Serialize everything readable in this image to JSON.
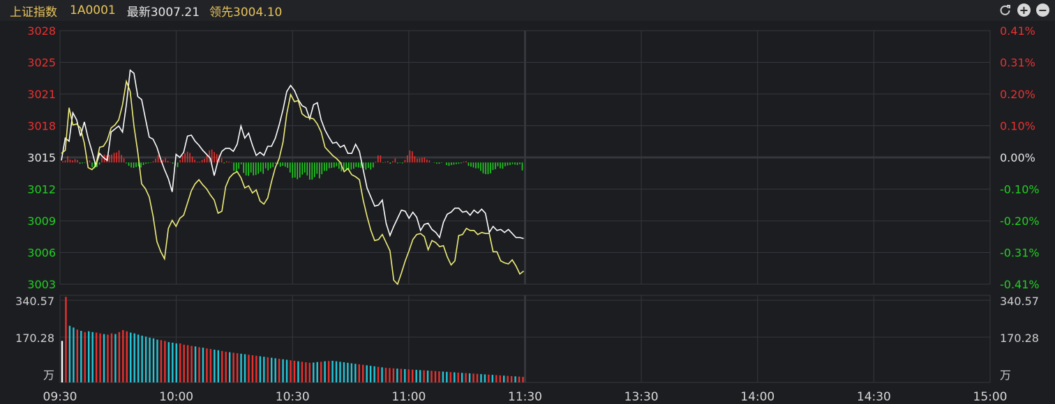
{
  "header": {
    "name": "上证指数",
    "code": "1A0001",
    "last_label": "最新3007.21",
    "lead_label": "领先3004.10"
  },
  "toolbar": {
    "refresh_icon": "refresh-icon",
    "zoom_in_icon": "zoom-in-icon",
    "zoom_out_icon": "zoom-out-icon"
  },
  "colors": {
    "up": "#e8312f",
    "down": "#1fd21f",
    "price_line": "#ffffff",
    "lead_line": "#f0ee7a",
    "vol_up": "#e8312f",
    "vol_down": "#25c6d6",
    "grid": "#36373c"
  },
  "chart_data": [
    {
      "type": "line",
      "title": "",
      "x": [
        "09:30",
        "10:00",
        "10:30",
        "11:00",
        "11:30",
        "13:30",
        "14:00",
        "14:30",
        "15:00"
      ],
      "y_ticks": [
        "3028",
        "3025",
        "3021",
        "3018",
        "3015",
        "3012",
        "3009",
        "3006",
        "3003"
      ],
      "y_tick_values": [
        3028,
        3025,
        3021,
        3018,
        3015,
        3012,
        3009,
        3006,
        3003
      ],
      "pct_ticks": [
        "0.41%",
        "0.31%",
        "0.20%",
        "0.10%",
        "0.00%",
        "-0.10%",
        "-0.20%",
        "-0.31%",
        "-0.41%"
      ],
      "base": 3015,
      "ylim": [
        3003,
        3028
      ],
      "series": [
        {
          "values": [
            3015.2,
            3017.4,
            3017.1,
            3019.9,
            3019.2,
            3017.6,
            3019.0,
            3017.4,
            3016.1,
            3014.7,
            3015.9,
            3015.5,
            3015.2,
            3018.0,
            3018.3,
            3018.6,
            3018.0,
            3020.7,
            3024.1,
            3023.8,
            3021.5,
            3021.2,
            3019.3,
            3017.5,
            3017.3,
            3016.5,
            3015.3,
            3014.3,
            3013.4,
            3012.1,
            3015.8,
            3015.5,
            3016.0,
            3017.6,
            3017.7,
            3017.1,
            3016.7,
            3016.2,
            3015.8,
            3015.4,
            3013.7,
            3015.2,
            3016.1,
            3016.4,
            3016.4,
            3016.1,
            3016.8,
            3018.6,
            3017.4,
            3017.9,
            3016.7,
            3015.7,
            3016.0,
            3015.7,
            3016.6,
            3016.6,
            3017.4,
            3018.7,
            3020.2,
            3022.0,
            3022.6,
            3022.1,
            3021.2,
            3020.6,
            3020.4,
            3019.3,
            3020.7,
            3020.9,
            3019.2,
            3018.2,
            3017.5,
            3016.9,
            3017.0,
            3016.5,
            3016.7,
            3015.9,
            3015.9,
            3016.8,
            3016.1,
            3014.3,
            3012.5,
            3011.6,
            3010.7,
            3010.8,
            3011.3,
            3009.0,
            3007.8,
            3008.7,
            3009.5,
            3010.3,
            3010.2,
            3009.5,
            3010.1,
            3009.6,
            3008.3,
            3008.9,
            3009.0,
            3008.4,
            3008.1,
            3007.6,
            3009.1,
            3009.9,
            3010.1,
            3010.5,
            3010.5,
            3010.1,
            3010.2,
            3009.8,
            3010.3,
            3010.0,
            3010.4,
            3010.0,
            3008.1,
            3008.7,
            3008.3,
            3008.4,
            3008.1,
            3008.4,
            3008.0,
            3007.6,
            3007.6,
            3007.5
          ]
        },
        {
          "values": [
            3015.9,
            3016.2,
            3020.4,
            3018.7,
            3018.8,
            3018.4,
            3016.9,
            3014.5,
            3014.3,
            3014.7,
            3016.5,
            3016.6,
            3017.2,
            3018.4,
            3018.7,
            3019.2,
            3020.7,
            3023.0,
            3022.0,
            3018.6,
            3016.0,
            3012.9,
            3012.4,
            3011.6,
            3009.7,
            3007.2,
            3006.2,
            3005.5,
            3008.5,
            3009.3,
            3008.7,
            3009.5,
            3009.8,
            3011.0,
            3012.2,
            3012.9,
            3013.3,
            3012.8,
            3012.4,
            3011.8,
            3011.3,
            3010.0,
            3010.2,
            3012.6,
            3013.5,
            3013.9,
            3014.1,
            3013.5,
            3012.5,
            3012.7,
            3012.0,
            3012.3,
            3011.2,
            3010.9,
            3011.5,
            3013.1,
            3014.5,
            3015.4,
            3017.0,
            3019.8,
            3021.7,
            3021.0,
            3021.1,
            3019.8,
            3019.5,
            3019.4,
            3019.3,
            3018.8,
            3018.0,
            3016.5,
            3016.1,
            3015.7,
            3015.4,
            3015.0,
            3014.1,
            3014.4,
            3013.8,
            3013.6,
            3013.3,
            3011.3,
            3009.7,
            3008.3,
            3007.3,
            3007.4,
            3007.9,
            3007.1,
            3006.3,
            3003.4,
            3003.0,
            3004.1,
            3005.3,
            3006.3,
            3007.4,
            3007.9,
            3008.0,
            3007.7,
            3006.4,
            3007.3,
            3007.1,
            3006.7,
            3006.8,
            3005.7,
            3004.9,
            3005.3,
            3007.8,
            3007.9,
            3008.5,
            3008.3,
            3008.3,
            3007.9,
            3008.1,
            3008.0,
            3008.0,
            3006.2,
            3006.2,
            3005.3,
            3005.1,
            3005.0,
            3005.4,
            3004.8,
            3004.0,
            3004.3
          ]
        }
      ],
      "diff_bars": [
        0.3,
        0.5,
        1.5,
        0.7,
        0.5,
        0.8,
        0.6,
        -0.3,
        -0.2,
        -0.1,
        0.4,
        0.5,
        -1.1,
        -1.4,
        -1.1,
        -0.5,
        1.1,
        1.9,
        1.7,
        1.8,
        1.9,
        2.3,
        2.4,
        2.9,
        1.8,
        1.0,
        -0.2,
        -0.8,
        -1.2,
        -1.3,
        -1.1,
        -0.9,
        -1.2,
        -0.6,
        -0.3,
        -0.2,
        -0.1,
        0.3,
        0.9,
        1.8,
        0.4,
        0.7,
        1.1,
        0.4,
        0.1,
        -0.3,
        -0.7,
        -1.1,
        0.6,
        1.7,
        2.2,
        2.6,
        2.3,
        1.4,
        0.7,
        0.2,
        0.2,
        0.6,
        0.9,
        1.9,
        2.9,
        3.1,
        2.5,
        2.0,
        1.8,
        1.0,
        -0.2,
        0.3,
        0.2,
        0.1,
        -2.0,
        -2.3,
        -1.5,
        -0.4,
        -2.5,
        -3.1,
        -3.2,
        -2.4,
        -3.1,
        -3.0,
        -2.7,
        -2.2,
        -2.7,
        -1.4,
        -1.9,
        -1.4,
        -1.1,
        -0.3,
        -0.4,
        -1.0,
        -0.8,
        -1.0,
        -1.3,
        -2.4,
        -3.7,
        -3.6,
        -4.0,
        -3.6,
        -2.9,
        -2.4,
        -3.1,
        -4.1,
        -4.1,
        -3.5,
        -2.7,
        -3.8,
        -2.8,
        -2.0,
        -2.0,
        -1.4,
        -1.3,
        -1.2,
        -0.9,
        -1.5,
        -2.1,
        -1.7,
        -1.6,
        -1.8,
        -1.7,
        -1.5,
        -1.1,
        -1.2,
        -1.3,
        -1.3,
        -1.7,
        -1.3,
        -1.7,
        -1.2,
        0.2,
        1.7,
        1.7,
        -0.1,
        0.2,
        0.3,
        -0.3,
        0.3,
        1.0,
        -0.2,
        -0.1,
        -0.2,
        0.6,
        1.7,
        2.9,
        2.7,
        1.5,
        0.9,
        1.0,
        1.1,
        1.2,
        0.7,
        0.5,
        0.0,
        -0.1,
        -0.3,
        -0.3,
        -0.1,
        0.0,
        -0.6,
        -0.8,
        -0.6,
        -0.5,
        -0.4,
        -0.3,
        -0.2,
        0.2,
        0.3,
        -0.8,
        -1.0,
        -1.2,
        -1.4,
        -1.4,
        -2.0,
        -2.6,
        -2.8,
        -2.8,
        -2.6,
        -1.8,
        -1.6,
        -0.9,
        -1.4,
        -1.5,
        -0.9,
        -0.7,
        -0.6,
        -0.4,
        -0.5,
        -0.6,
        -0.4,
        -1.9
      ]
    },
    {
      "type": "bar",
      "title": "",
      "y_ticks": [
        "340.57",
        "170.28",
        "万"
      ],
      "ylim": [
        0,
        340.57
      ],
      "values": [
        165,
        340,
        225,
        218,
        210,
        205,
        200,
        203,
        200,
        198,
        195,
        192,
        190,
        195,
        192,
        200,
        208,
        203,
        198,
        195,
        190,
        186,
        182,
        178,
        175,
        170,
        168,
        165,
        160,
        158,
        155,
        155,
        150,
        148,
        145,
        143,
        140,
        138,
        135,
        133,
        130,
        128,
        125,
        122,
        120,
        118,
        116,
        114,
        112,
        110,
        108,
        106,
        104,
        102,
        100,
        98,
        96,
        94,
        92,
        90,
        88,
        86,
        84,
        82,
        80,
        78,
        79,
        81,
        82,
        84,
        85,
        86,
        84,
        82,
        80,
        78,
        76,
        74,
        72,
        70,
        68,
        66,
        64,
        62,
        60,
        58,
        57,
        56,
        55,
        54,
        53,
        52,
        51,
        50,
        49,
        48,
        47,
        46,
        45,
        44,
        43,
        42,
        41,
        40,
        39,
        38,
        37,
        36,
        35,
        34,
        33,
        32,
        31,
        30,
        29,
        28,
        27,
        26,
        25,
        24,
        23,
        22
      ],
      "up": [
        1,
        1,
        0,
        0,
        1,
        0,
        1,
        0,
        0,
        1,
        1,
        0,
        1,
        1,
        0,
        1,
        1,
        1,
        0,
        0,
        0,
        0,
        0,
        0,
        0,
        0,
        1,
        1,
        0,
        0,
        0,
        1,
        1,
        1,
        1,
        0,
        1,
        0,
        1,
        1,
        0,
        0,
        1,
        1,
        0,
        1,
        1,
        0,
        0,
        1,
        1,
        1,
        0,
        0,
        1,
        0,
        0,
        1,
        0,
        0,
        1,
        1,
        0,
        1,
        1,
        1,
        0,
        0,
        1,
        0,
        1,
        0,
        0,
        0,
        0,
        0,
        0,
        0,
        1,
        1,
        0,
        0,
        0,
        1,
        0,
        1,
        1,
        1,
        0,
        1,
        0,
        1,
        1,
        0,
        0,
        1,
        0,
        1,
        1,
        1,
        0,
        0,
        1,
        0,
        1,
        0,
        1,
        0,
        1,
        1,
        0,
        0,
        1,
        0,
        1,
        1,
        0,
        1,
        1,
        0,
        1,
        1
      ]
    }
  ]
}
